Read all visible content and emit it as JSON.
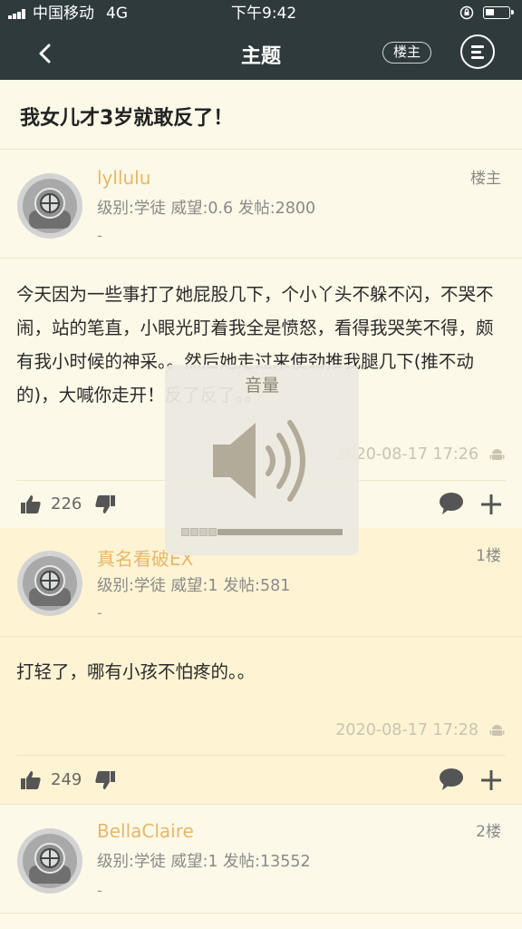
{
  "status_bar": {
    "carrier": "中国移动",
    "network": "4G",
    "time": "下午9:42"
  },
  "nav": {
    "title": "主题",
    "owner_button": "楼主"
  },
  "topic": {
    "title": "我女儿才3岁就敢反了！"
  },
  "posts": [
    {
      "username": "lyllulu",
      "floor": "楼主",
      "meta": "级别:学徒  威望:0.6  发帖:2800",
      "signature": "-",
      "content": "今天因为一些事打了她屁股几下，个小丫头不躲不闪，不哭不闹，站的笔直，小眼光盯着我全是愤怒，看得我哭笑不得，颇有我小时候的神采。。然后她走过来使劲推我腿几下(推不动的)，大喊你走开！反了反了。。",
      "time": "2020-08-17 17:26",
      "likes": "226"
    },
    {
      "username": "真名看破EX",
      "floor": "1楼",
      "meta": "级别:学徒  威望:1  发帖:581",
      "signature": "-",
      "content": "打轻了，哪有小孩不怕疼的。。",
      "time": "2020-08-17 17:28",
      "likes": "249"
    },
    {
      "username": "BellaClaire",
      "floor": "2楼",
      "meta": "级别:学徒  威望:1  发帖:13552",
      "signature": "-"
    }
  ],
  "volume_hud": {
    "label": "音量",
    "level": 0.25
  },
  "colors": {
    "bar_bg": "#2f3a3d",
    "page_bg": "#fdf9e8",
    "username": "#e7b768"
  }
}
